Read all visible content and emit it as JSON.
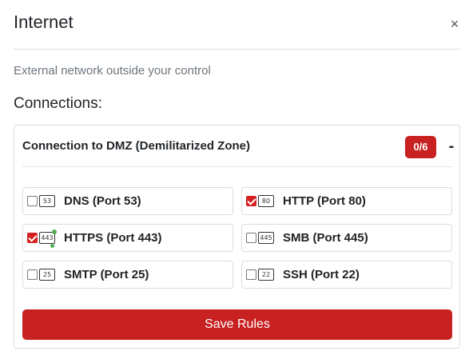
{
  "dialog": {
    "title": "Internet",
    "close_glyph": "×",
    "description": "External network outside your control",
    "connections_heading": "Connections:"
  },
  "connection": {
    "title": "Connection to DMZ (Demilitarized Zone)",
    "badge": "0/6",
    "collapse_glyph": "-",
    "services": [
      {
        "label": "DNS (Port 53)",
        "port": "53",
        "checked": false,
        "icon": "port-icon"
      },
      {
        "label": "HTTP (Port 80)",
        "port": "80",
        "checked": true,
        "icon": "port-icon"
      },
      {
        "label": "HTTPS (Port 443)",
        "port": "443",
        "checked": true,
        "icon": "port-icon-active"
      },
      {
        "label": "SMB (Port 445)",
        "port": "445",
        "checked": false,
        "icon": "port-icon"
      },
      {
        "label": "SMTP (Port 25)",
        "port": "25",
        "checked": false,
        "icon": "port-icon"
      },
      {
        "label": "SSH (Port 22)",
        "port": "22",
        "checked": false,
        "icon": "port-icon"
      }
    ],
    "save_label": "Save Rules"
  },
  "colors": {
    "accent": "#c82121",
    "muted_text": "#6c757d",
    "border": "#dcdcdc",
    "status_dot": "#4caf50"
  }
}
